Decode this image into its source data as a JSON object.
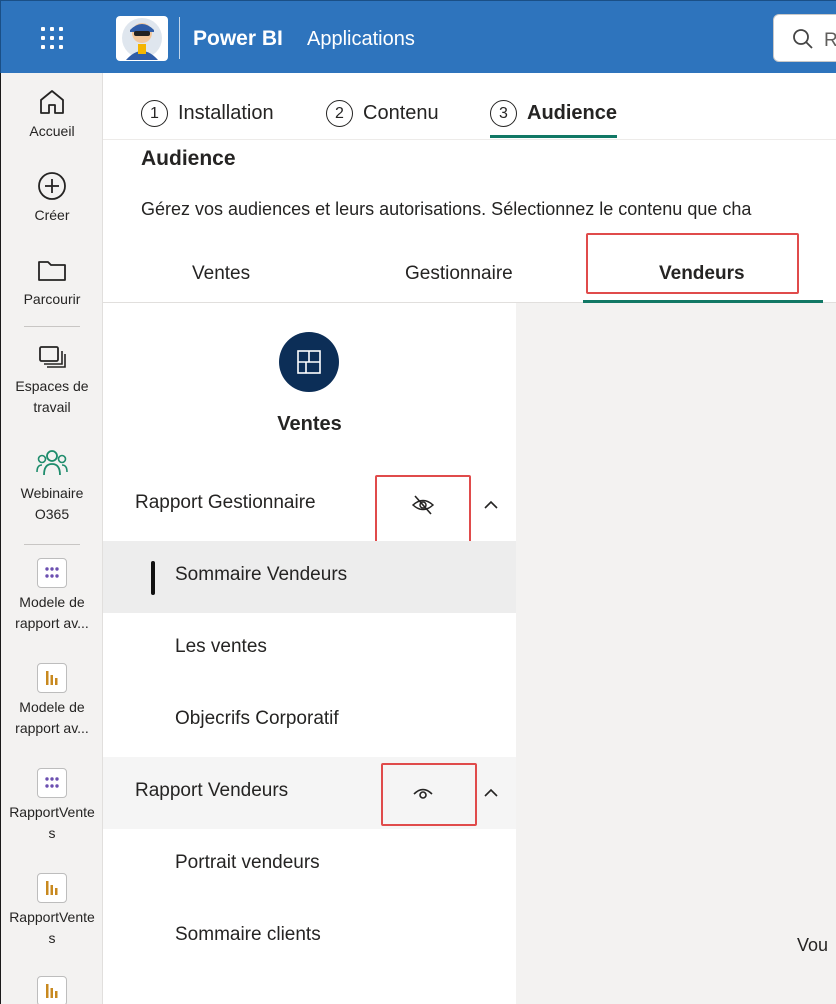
{
  "header": {
    "brand": "Power BI",
    "section": "Applications",
    "search_placeholder": "R"
  },
  "nav": {
    "items": [
      {
        "label": "Accueil",
        "icon": "home-icon"
      },
      {
        "label": "Créer",
        "icon": "plus-circle-icon"
      },
      {
        "label": "Parcourir",
        "icon": "folder-icon"
      },
      {
        "label": "Espaces de travail",
        "icon": "workspaces-icon"
      },
      {
        "label": "Webinaire O365",
        "icon": "people-icon"
      },
      {
        "label": "Modele de rapport av...",
        "icon": "app-grid-icon"
      },
      {
        "label": "Modele de rapport av...",
        "icon": "report-chart-icon"
      },
      {
        "label": "RapportVentes",
        "icon": "app-grid-icon"
      },
      {
        "label": "RapportVentes",
        "icon": "report-chart-icon"
      }
    ]
  },
  "steps": [
    {
      "number": "1",
      "label": "Installation"
    },
    {
      "number": "2",
      "label": "Contenu"
    },
    {
      "number": "3",
      "label": "Audience"
    }
  ],
  "audience": {
    "title": "Audience",
    "description": "Gérez vos audiences et leurs autorisations. Sélectionnez le contenu que cha"
  },
  "tabs": [
    {
      "label": "Ventes"
    },
    {
      "label": "Gestionnaire"
    },
    {
      "label": "Vendeurs"
    }
  ],
  "content": {
    "app_name": "Ventes",
    "groups": [
      {
        "label": "Rapport Gestionnaire",
        "visibility": "hidden",
        "pages": [
          {
            "label": "Sommaire Vendeurs",
            "selected": true
          },
          {
            "label": "Les ventes"
          },
          {
            "label": "Objecrifs Corporatif"
          }
        ]
      },
      {
        "label": "Rapport Vendeurs",
        "visibility": "visible",
        "pages": [
          {
            "label": "Portrait vendeurs"
          },
          {
            "label": "Sommaire clients"
          }
        ]
      }
    ],
    "right_text": "Vou"
  },
  "colors": {
    "header_blue": "#2e74bd",
    "accent_green": "#117865",
    "highlight_red": "#e04b4b",
    "badge_navy": "#0c2e57"
  }
}
